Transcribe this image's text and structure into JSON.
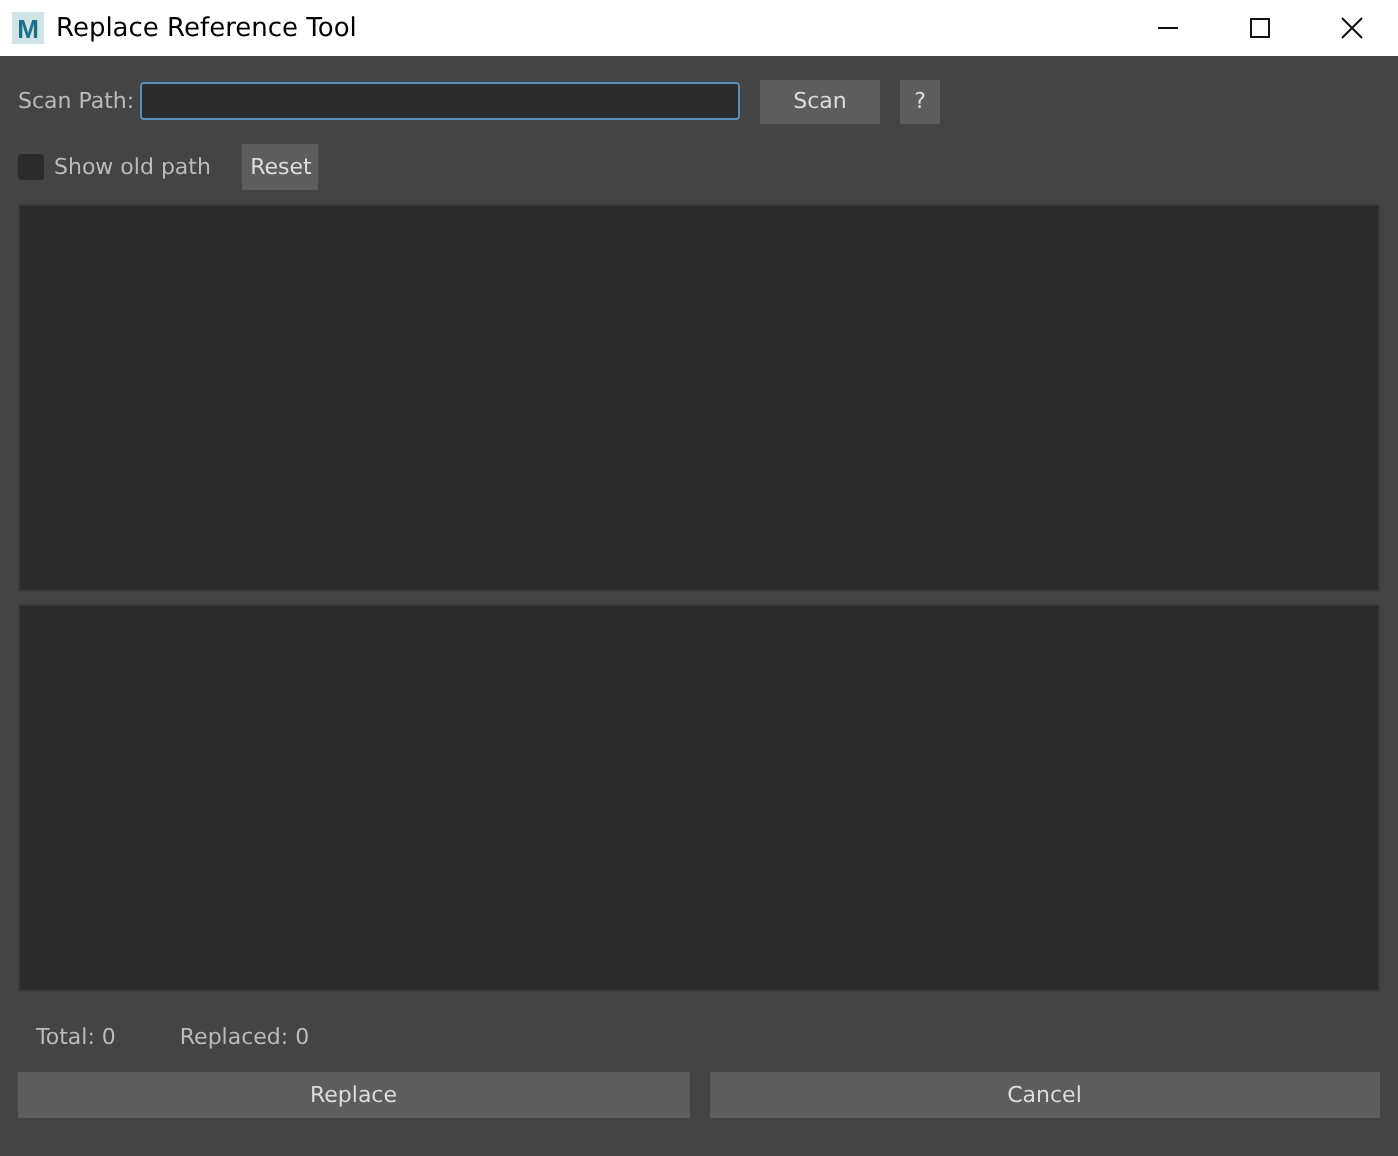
{
  "window": {
    "logo": "M",
    "title": "Replace Reference Tool"
  },
  "scan": {
    "label": "Scan Path:",
    "scan_button": "Scan",
    "help_button": "?"
  },
  "options": {
    "show_old_path": {
      "label": "Show old path",
      "checked": false
    },
    "reset_button": "Reset"
  },
  "status": {
    "total": "Total: 0",
    "replaced": "Replaced: 0"
  },
  "buttons": [
    "Replace",
    "Cancel"
  ]
}
